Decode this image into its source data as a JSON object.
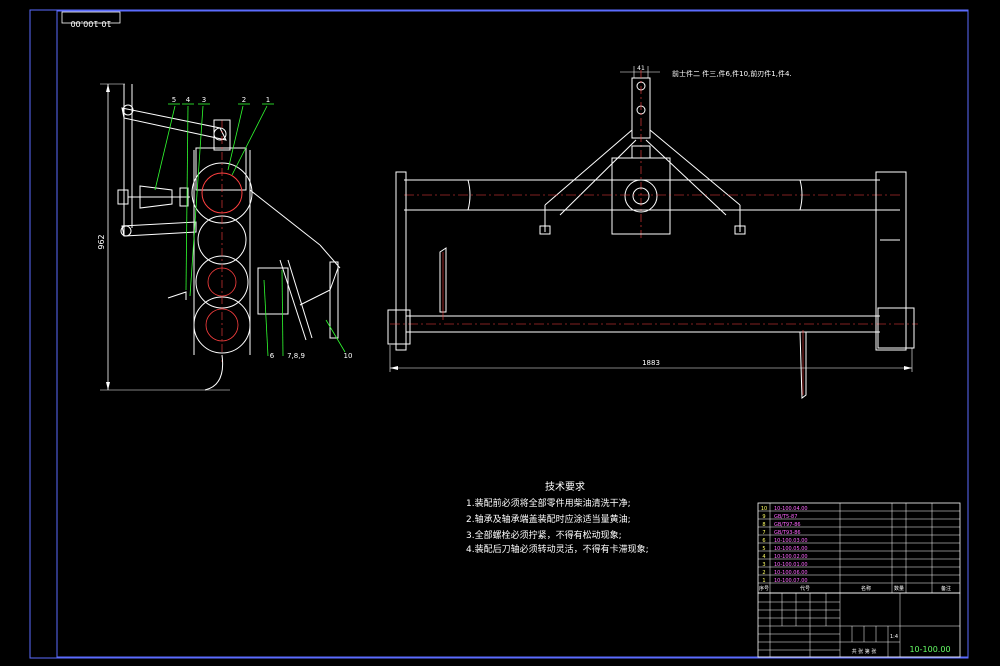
{
  "drawing_no_rotated": "10-100.00",
  "side_dim": "962",
  "front_dim_width": "1883",
  "front_dim_top": "41",
  "front_note": "前士件二 件三,件6,件10,前刃件1,件4.",
  "balloons_top": [
    "5",
    "4",
    "3",
    "2",
    "1"
  ],
  "balloons_bottom": [
    "6",
    "7,8,9",
    "10"
  ],
  "tech": {
    "title": "技术要求",
    "items": [
      "1.装配前必须将全部零件用柴油清洗干净;",
      "2.轴承及轴承端盖装配时应涂适当量黄油;",
      "3.全部螺栓必须拧紧，不得有松动现象;",
      "4.装配后刀轴必须转动灵活，不得有卡滞现象;"
    ]
  },
  "bom": {
    "rows": [
      {
        "no": "10",
        "code": "10-100.04.00"
      },
      {
        "no": "9",
        "code": "GB/T5-87"
      },
      {
        "no": "8",
        "code": "GB/T97-86"
      },
      {
        "no": "7",
        "code": "GB/T93-86"
      },
      {
        "no": "6",
        "code": "10-100.03.00"
      },
      {
        "no": "5",
        "code": "10-100.05.00"
      },
      {
        "no": "4",
        "code": "10-100.02.00"
      },
      {
        "no": "3",
        "code": "10-100.01.00"
      },
      {
        "no": "2",
        "code": "10-100.06.00"
      },
      {
        "no": "1",
        "code": "10-100.07.00"
      }
    ],
    "header": {
      "no": "序号",
      "code": "代号",
      "name": "名称",
      "qty": "数量",
      "note": "备注"
    }
  },
  "title_block": {
    "drawing_no": "10-100.00",
    "scale": "1:4",
    "sheet": "共 张 第 张"
  }
}
